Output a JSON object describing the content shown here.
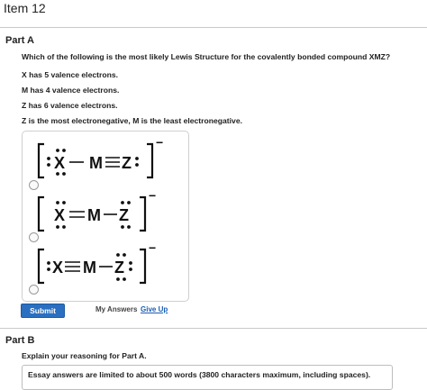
{
  "item": {
    "title": "Item 12"
  },
  "part_a": {
    "label": "Part A",
    "question": "Which of the following is the most likely Lewis Structure for the covalently bonded compound XMZ?",
    "facts": [
      "X has 5 valence electrons.",
      "M has 4 valence electrons.",
      "Z has 6 valence electrons.",
      "Z is the most electronegative, M is the least electronegative."
    ],
    "choices": [
      {
        "atoms": [
          "X",
          "M",
          "Z"
        ],
        "charge": "−"
      },
      {
        "atoms": [
          "X",
          "M",
          "Z"
        ],
        "charge": "−"
      },
      {
        "atoms": [
          "X",
          "M",
          "Z"
        ],
        "charge": "−"
      }
    ],
    "submit_label": "Submit",
    "my_answers_label": "My Answers",
    "give_up_label": "Give Up"
  },
  "part_b": {
    "label": "Part B",
    "prompt": "Explain your reasoning for Part A.",
    "essay_placeholder": "Essay answers are limited to about 500 words (3800 characters maximum, including spaces)."
  }
}
